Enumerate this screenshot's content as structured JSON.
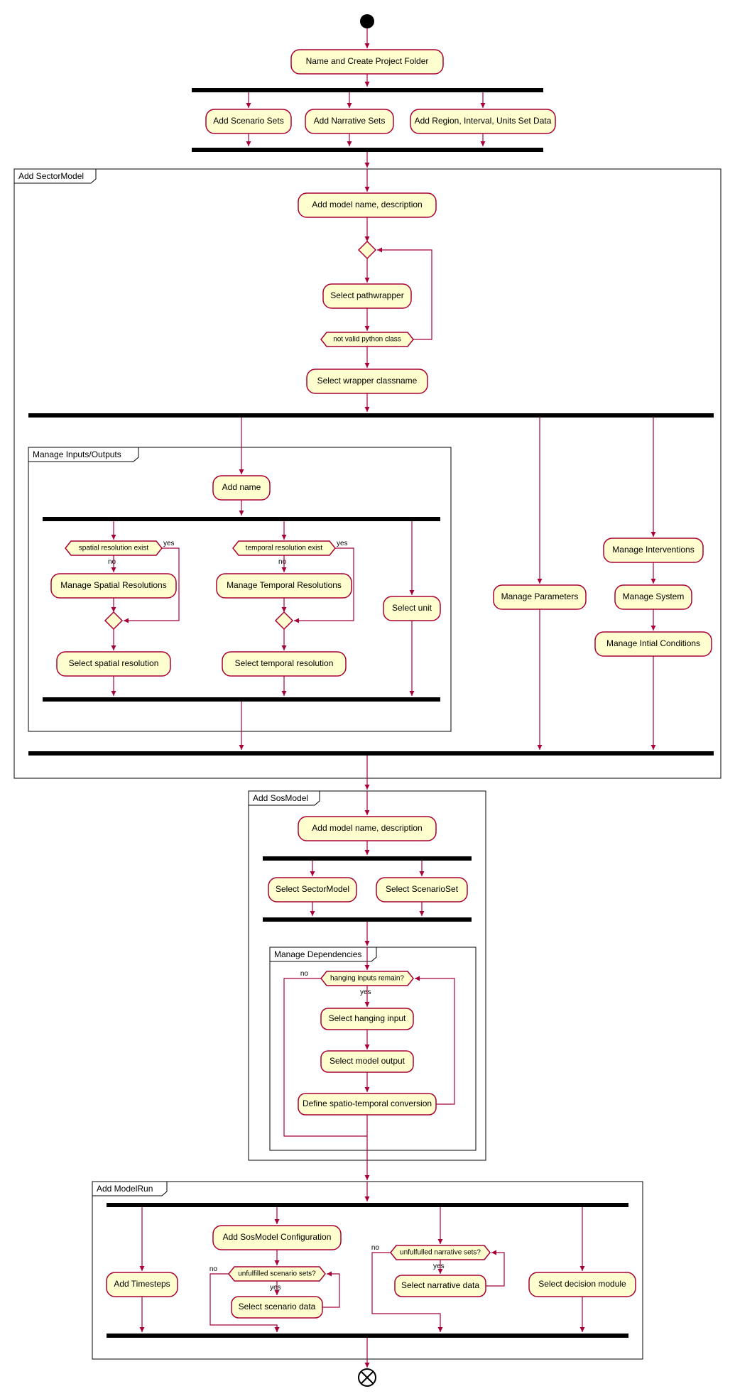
{
  "type": "uml-activity-diagram",
  "colors": {
    "node_fill": "#FEFECE",
    "stroke": "#A80036",
    "bar": "#000000"
  },
  "start": "initial-node",
  "end": "flow-final",
  "nodes": {
    "n_create": "Name and Create Project Folder",
    "n_scen": "Add Scenario Sets",
    "n_narr": "Add Narrative Sets",
    "n_region": "Add Region, Interval, Units Set Data",
    "frame_sector": "Add SectorModel",
    "n_mdesc": "Add model name, description",
    "n_pathw": "Select pathwrapper",
    "d_valid": "not valid python class",
    "n_wrapcls": "Select wrapper classname",
    "frame_io": "Manage Inputs/Outputs",
    "n_addname": "Add name",
    "d_spatial": "spatial resolution exist",
    "n_mspatial": "Manage Spatial Resolutions",
    "n_selspatial": "Select spatial resolution",
    "d_temporal": "temporal resolution exist",
    "n_mtemporal": "Manage Temporal Resolutions",
    "n_seltemporal": "Select temporal resolution",
    "n_selunit": "Select unit",
    "n_mparams": "Manage Parameters",
    "n_minterv": "Manage Interventions",
    "n_msys": "Manage System",
    "n_minit": "Manage Intial Conditions",
    "frame_sos": "Add SosModel",
    "n_sosdesc": "Add model name, description",
    "n_selsector": "Select SectorModel",
    "n_selscenset": "Select ScenarioSet",
    "frame_dep": "Manage Dependencies",
    "d_hanging": "hanging inputs remain?",
    "n_selhang": "Select hanging input",
    "n_selout": "Select model output",
    "n_defconv": "Define spatio-temporal conversion",
    "frame_run": "Add ModelRun",
    "n_addts": "Add Timesteps",
    "n_addsoscfg": "Add SosModel Configuration",
    "d_unfscen": "unfulfilled scenario sets?",
    "n_selscendata": "Select scenario data",
    "d_unfnarr": "unfulfulled narrative sets?",
    "n_selnarrdata": "Select narrative data",
    "n_seldec": "Select decision module",
    "lbl_yes": "yes",
    "lbl_no": "no"
  }
}
